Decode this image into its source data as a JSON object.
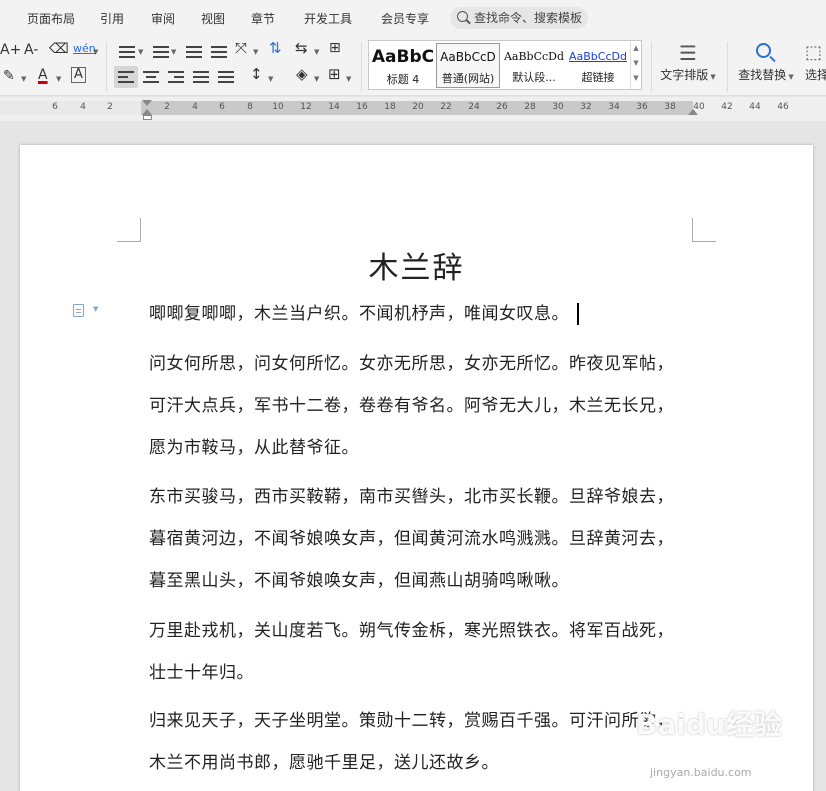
{
  "menu": {
    "tabs": [
      "页面布局",
      "引用",
      "审阅",
      "视图",
      "章节",
      "开发工具",
      "会员专享"
    ],
    "search_label": "查找命令、搜索模板"
  },
  "toolbar": {
    "font_grow": "A+",
    "font_shrink": "A-",
    "font_color": "A",
    "char_border": "A",
    "phonetic": "wén",
    "styles": [
      {
        "sample": "AaBbC",
        "name": "标题 4"
      },
      {
        "sample": "AaBbCcD",
        "name": "普通(网站)"
      },
      {
        "sample": "AaBbCcDd",
        "name": "默认段..."
      },
      {
        "sample": "AaBbCcDd",
        "name": "超链接"
      }
    ],
    "text_layout": "文字排版",
    "find_replace": "查找替换",
    "select": "选择"
  },
  "ruler": {
    "left_ticks": [
      "6",
      "4",
      "2"
    ],
    "ticks": [
      "2",
      "4",
      "6",
      "8",
      "10",
      "12",
      "14",
      "16",
      "18",
      "20",
      "22",
      "24",
      "26",
      "28",
      "30",
      "32",
      "34",
      "36",
      "38",
      "40",
      "42",
      "44",
      "46"
    ]
  },
  "document": {
    "title": "木兰辞",
    "lines": [
      "唧唧复唧唧，木兰当户织。不闻机杼声，唯闻女叹息。",
      "问女何所思，问女何所忆。女亦无所思，女亦无所忆。昨夜见军帖，",
      "可汗大点兵，军书十二卷，卷卷有爷名。阿爷无大儿，木兰无长兄，",
      "愿为市鞍马，从此替爷征。",
      "东市买骏马，西市买鞍鞯，南市买辔头，北市买长鞭。旦辞爷娘去，",
      "暮宿黄河边，不闻爷娘唤女声，但闻黄河流水鸣溅溅。旦辞黄河去，",
      "暮至黑山头，不闻爷娘唤女声，但闻燕山胡骑鸣啾啾。",
      "万里赴戎机，关山度若飞。朔气传金柝，寒光照铁衣。将军百战死，",
      "壮士十年归。",
      "归来见天子，天子坐明堂。策勋十二转，赏赐百千强。可汗问所欲，",
      "木兰不用尚书郎，愿驰千里足，送儿还故乡。"
    ]
  },
  "watermark": {
    "text": "Baidu经验",
    "sub": "jingyan.baidu.com"
  },
  "colors": {
    "accent": "#2b6fd6",
    "hyperlink": "#1a3fd1"
  }
}
